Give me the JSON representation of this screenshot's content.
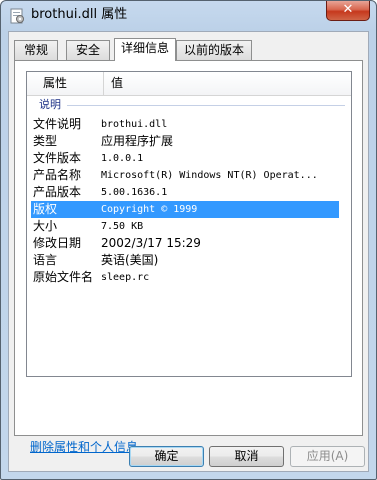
{
  "window": {
    "title": "brothui.dll 属性",
    "close_label": "✕"
  },
  "tabs": [
    {
      "label": "常规"
    },
    {
      "label": "安全"
    },
    {
      "label": "详细信息"
    },
    {
      "label": "以前的版本"
    }
  ],
  "list": {
    "columns": {
      "property": "属性",
      "value": "值"
    },
    "group_label": "说明",
    "rows": [
      {
        "key": "文件说明",
        "value": "brothui.dll"
      },
      {
        "key": "类型",
        "value": "应用程序扩展"
      },
      {
        "key": "文件版本",
        "value": "1.0.0.1"
      },
      {
        "key": "产品名称",
        "value": "Microsoft(R) Windows NT(R) Operat..."
      },
      {
        "key": "产品版本",
        "value": "5.00.1636.1"
      },
      {
        "key": "版权",
        "value": "Copyright © 1999"
      },
      {
        "key": "大小",
        "value": "7.50 KB"
      },
      {
        "key": "修改日期",
        "value": "2002/3/17 15:29"
      },
      {
        "key": "语言",
        "value": "英语(美国)"
      },
      {
        "key": "原始文件名",
        "value": "sleep.rc"
      }
    ]
  },
  "remove_link": "删除属性和个人信息",
  "buttons": {
    "ok": "确定",
    "cancel": "取消",
    "apply": "应用(A)"
  },
  "colors": {
    "selection": "#3399ff",
    "link": "#0066cc"
  }
}
